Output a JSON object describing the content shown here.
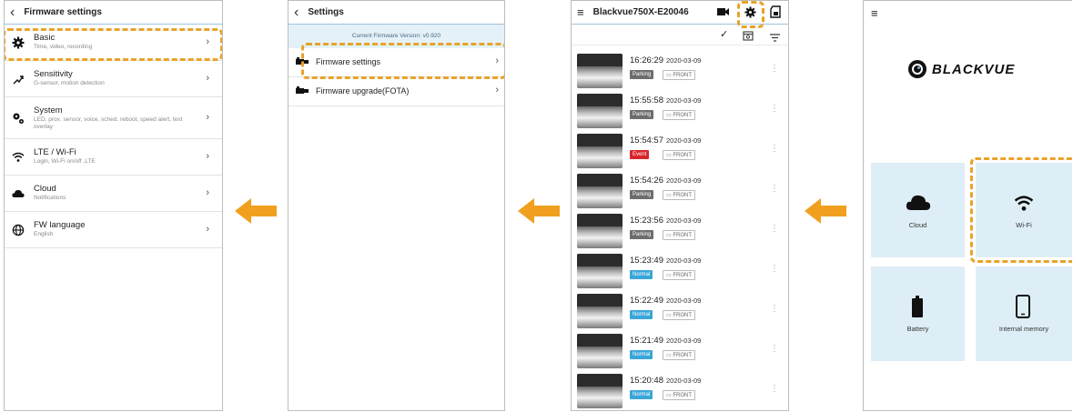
{
  "panel1": {
    "title": "Firmware settings",
    "items": [
      {
        "icon": "gear-icon",
        "label": "Basic",
        "sub": "Time, video, recording"
      },
      {
        "icon": "sensitivity-icon",
        "label": "Sensitivity",
        "sub": "G-sensor, motion detection"
      },
      {
        "icon": "system-gears-icon",
        "label": "System",
        "sub": "LED, prox. sensor, voice, sched. reboot, speed alert, text overlay"
      },
      {
        "icon": "wifi-icon",
        "label": "LTE / Wi-Fi",
        "sub": "Login, Wi-Fi on/off ,LTE"
      },
      {
        "icon": "cloud-icon",
        "label": "Cloud",
        "sub": "Notifications"
      },
      {
        "icon": "globe-icon",
        "label": "FW language",
        "sub": "English"
      }
    ]
  },
  "panel2": {
    "title": "Settings",
    "banner": "Current Firmware Version: v0.920",
    "items": [
      {
        "icon": "dashcam-icon",
        "label": "Firmware settings"
      },
      {
        "icon": "dashcam-icon",
        "label": "Firmware upgrade(FOTA)"
      }
    ]
  },
  "panel3": {
    "title": "Blackvue750X-E20046",
    "records": [
      {
        "time": "16:26:29",
        "date": "2020-03-09",
        "mode": "Parking",
        "cam": "FRONT"
      },
      {
        "time": "15:55:58",
        "date": "2020-03-09",
        "mode": "Parking",
        "cam": "FRONT"
      },
      {
        "time": "15:54:57",
        "date": "2020-03-09",
        "mode": "Event",
        "cam": "FRONT"
      },
      {
        "time": "15:54:26",
        "date": "2020-03-09",
        "mode": "Parking",
        "cam": "FRONT"
      },
      {
        "time": "15:23:56",
        "date": "2020-03-09",
        "mode": "Parking",
        "cam": "FRONT"
      },
      {
        "time": "15:23:49",
        "date": "2020-03-09",
        "mode": "Normal",
        "cam": "FRONT"
      },
      {
        "time": "15:22:49",
        "date": "2020-03-09",
        "mode": "Normal",
        "cam": "FRONT"
      },
      {
        "time": "15:21:49",
        "date": "2020-03-09",
        "mode": "Normal",
        "cam": "FRONT"
      },
      {
        "time": "15:20:48",
        "date": "2020-03-09",
        "mode": "Normal",
        "cam": "FRONT"
      }
    ]
  },
  "panel4": {
    "logo": "BLACKVUE",
    "tiles": [
      {
        "icon": "cloud-icon",
        "label": "Cloud"
      },
      {
        "icon": "wifi-icon",
        "label": "Wi-Fi"
      },
      {
        "icon": "battery-icon",
        "label": "Battery"
      },
      {
        "icon": "phone-icon",
        "label": "Internal memory"
      }
    ]
  },
  "colors": {
    "highlight": "#e8a32a",
    "arrow": "#f0a01e",
    "parking": "#6d6d6d",
    "event": "#d9252b",
    "normal": "#3aa6d8",
    "tile": "#deeef7"
  }
}
